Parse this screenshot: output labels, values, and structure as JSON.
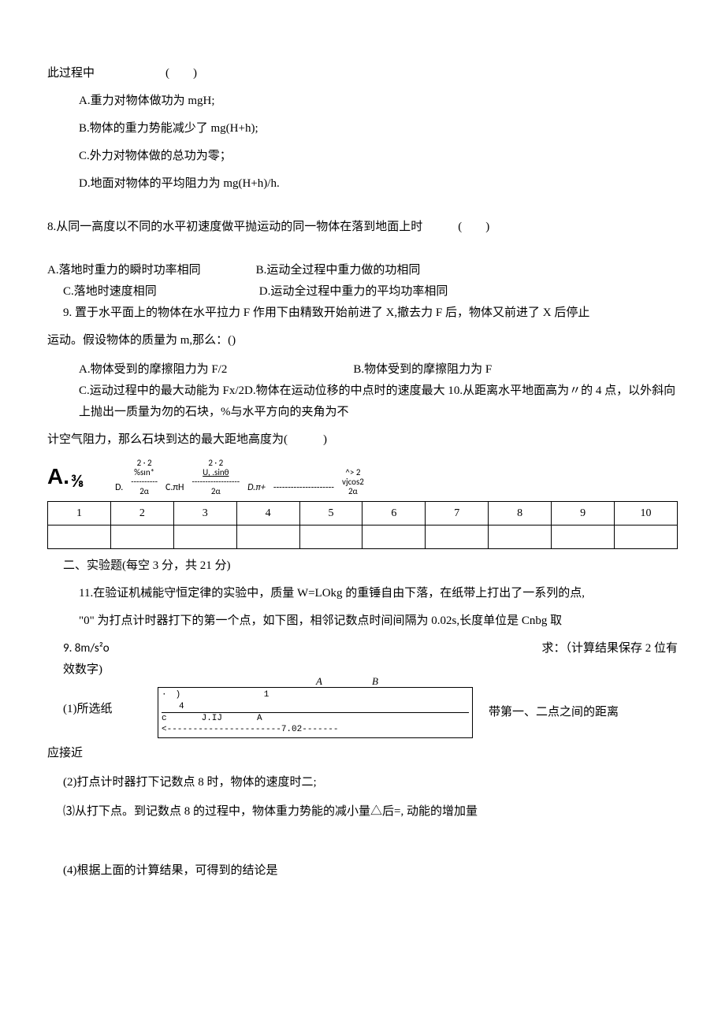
{
  "q7": {
    "intro": "此过程中      (  )",
    "a": "A.重力对物体做功为 mgH;",
    "b": "B.物体的重力势能减少了 mg(H+h);",
    "c": "C.外力对物体做的总功为零；",
    "d": "D.地面对物体的平均阻力为 mg(H+h)/h."
  },
  "q8": {
    "stem": "8.从同一高度以不同的水平初速度做平抛运动的同一物体在落到地面上时   (  )",
    "a": "A.落地时重力的瞬时功率相同",
    "b": "B.运动全过程中重力做的功相同",
    "c": "C.落地时速度相同",
    "d": "D.运动全过程中重力的平均功率相同"
  },
  "q9": {
    "stem": "9. 置于水平面上的物体在水平拉力 F 作用下由精致开始前进了 X,撤去力 F 后，物体又前进了 X 后停止",
    "stem2": "运动。假设物体的质量为 m,那么：()",
    "a": "A.物体受到的摩擦阻力为 F/2",
    "b": "B.物体受到的摩擦阻力为 F",
    "cd": "C.运动过程中的最大动能为 Fx/2D.物体在运动位移的中点时的速度最大 10.从距离水平地面高为〃的 4 点，以外斜向上抛出一质量为勿的石块，%与水平方向的夹角为不"
  },
  "q10": {
    "stem": "计空气阻力，那么石块到达的最大距地高度为(   )",
    "bigA": "A.",
    "frac": "3⁄8",
    "top1": "2 · 2",
    "mid1": "%sın*",
    "D": "D.",
    "cpi": "C.πH",
    "top2": "2 · 2",
    "mid2": "U, .sinθ",
    "dpi": "D.π+",
    "top3": "^>    2",
    "mid3": "vjcos2",
    "denom": "2α"
  },
  "table": {
    "row1": [
      "1",
      "2",
      "3",
      "4",
      "5",
      "6",
      "7",
      "8",
      "9",
      "10"
    ],
    "row2": [
      "",
      "",
      "",
      "",
      "",
      "",
      "",
      "",
      "",
      ""
    ]
  },
  "sec2": "二、实验题(每空 3 分，共 21 分)",
  "q11": {
    "stem": "11.在验证机械能守恒定律的实验中，质量 W=LOkg 的重锤自由下落，在纸带上打出了一系列的点,",
    "stem2": "\"0\" 为打点计时器打下的第一个点，如下图，相邻记数点时间间隔为 0.02s,长度单位是 Cnbg 取",
    "left1": "9. 8m/s²o",
    "right1": "求：（计算结果保存 2 位有",
    "left2": "效数字)",
    "diagLabelA": "A",
    "diagLabelB": "B",
    "diagLine1": "· )          1",
    "diagLine2": "  4",
    "diagLine3": "c    J.IJ    A",
    "diagLine4": "<----------------------7.02-------",
    "p1left": "(1)所选纸",
    "p1right": "带第一、二点之间的距离",
    "p1b": "应接近",
    "p2": "(2)打点计时器打下记数点 8 时，物体的速度时二;",
    "p3": "⑶从打下点。到记数点 8 的过程中，物体重力势能的减小量△后=, 动能的增加量",
    "p4": "(4)根据上面的计算结果，可得到的结论是"
  }
}
